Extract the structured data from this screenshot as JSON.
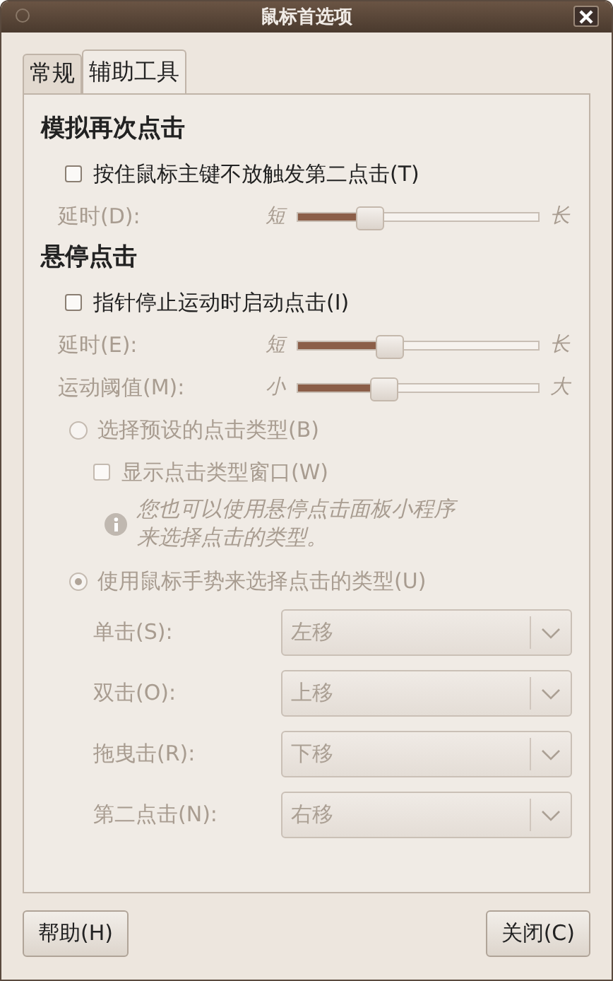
{
  "window": {
    "title": "鼠标首选项"
  },
  "tabs": [
    {
      "label": "常规",
      "selected": false
    },
    {
      "label": "辅助工具",
      "selected": true
    }
  ],
  "sections": [
    {
      "heading": "模拟再次点击",
      "items": [
        {
          "kind": "checkbox",
          "label": "按住鼠标主键不放触发第二点击(T)",
          "checked": false,
          "disabled": false
        },
        {
          "kind": "slider",
          "label": "延时(D):",
          "min_label": "短",
          "max_label": "长",
          "level": 0.3,
          "disabled": true
        }
      ]
    },
    {
      "heading": "悬停点击",
      "items": [
        {
          "kind": "checkbox",
          "label": "指针停止运动时启动点击(I)",
          "checked": false,
          "disabled": false
        },
        {
          "kind": "slider",
          "label": "延时(E):",
          "min_label": "短",
          "max_label": "长",
          "level": 0.38,
          "disabled": true
        },
        {
          "kind": "slider",
          "label": "运动阈值(M):",
          "min_label": "小",
          "max_label": "大",
          "level": 0.36,
          "disabled": true
        },
        {
          "kind": "radio",
          "label": "选择预设的点击类型(B)",
          "selected": false,
          "disabled": true,
          "children": [
            {
              "kind": "checkbox",
              "label": "显示点击类型窗口(W)",
              "checked": false,
              "disabled": true
            },
            {
              "kind": "info",
              "text": "您也可以使用悬停点击面板小程序来选择点击的类型。"
            }
          ]
        },
        {
          "kind": "radio",
          "label": "使用鼠标手势来选择点击的类型(U)",
          "selected": true,
          "disabled": true,
          "children": [
            {
              "kind": "combo",
              "label": "单击(S):",
              "value": "左移",
              "disabled": true
            },
            {
              "kind": "combo",
              "label": "双击(O):",
              "value": "上移",
              "disabled": true
            },
            {
              "kind": "combo",
              "label": "拖曳击(R):",
              "value": "下移",
              "disabled": true
            },
            {
              "kind": "combo",
              "label": "第二点击(N):",
              "value": "右移",
              "disabled": true
            }
          ]
        }
      ]
    }
  ],
  "buttons": [
    {
      "label": "帮助(H)"
    },
    {
      "label": "关闭(C)"
    }
  ]
}
